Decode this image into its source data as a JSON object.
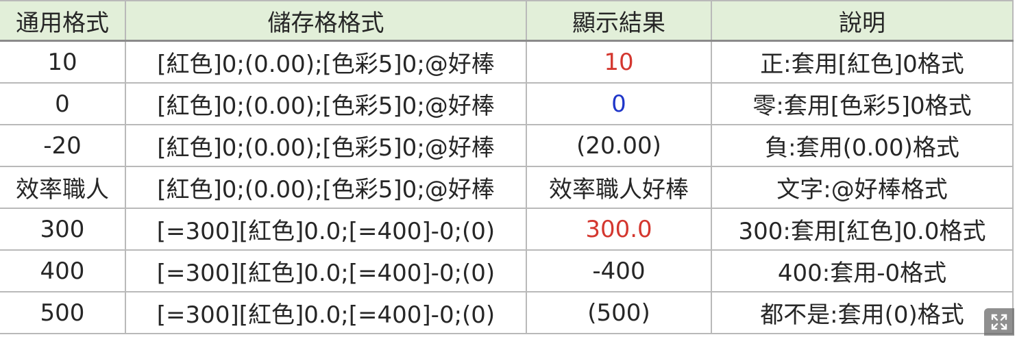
{
  "table": {
    "headers": [
      "通用格式",
      "儲存格格式",
      "顯示結果",
      "說明"
    ],
    "rows": [
      {
        "general": "10",
        "format": "[紅色]0;(0.00);[色彩5]0;@好棒",
        "result": "10",
        "desc": "正:套用[紅色]0格式",
        "result_color": "red"
      },
      {
        "general": "0",
        "format": "[紅色]0;(0.00);[色彩5]0;@好棒",
        "result": "0",
        "desc": "零:套用[色彩5]0格式",
        "result_color": "blue"
      },
      {
        "general": "-20",
        "format": "[紅色]0;(0.00);[色彩5]0;@好棒",
        "result": "(20.00)",
        "desc": "負:套用(0.00)格式",
        "result_color": "default"
      },
      {
        "general": "效率職人",
        "format": "[紅色]0;(0.00);[色彩5]0;@好棒",
        "result": "效率職人好棒",
        "desc": "文字:@好棒格式",
        "result_color": "default"
      },
      {
        "general": "300",
        "format": "[=300][紅色]0.0;[=400]-0;(0)",
        "result": "300.0",
        "desc": "300:套用[紅色]0.0格式",
        "result_color": "red"
      },
      {
        "general": "400",
        "format": "[=300][紅色]0.0;[=400]-0;(0)",
        "result": "-400",
        "desc": "400:套用-0格式",
        "result_color": "default"
      },
      {
        "general": "500",
        "format": "[=300][紅色]0.0;[=400]-0;(0)",
        "result": "(500)",
        "desc": "都不是:套用(0)格式",
        "result_color": "default"
      }
    ]
  },
  "colors": {
    "header_bg": "#e2efd9",
    "red": "#d4372f",
    "blue": "#1f36c9",
    "text": "#262626",
    "grid": "#b9b9b9"
  },
  "icons": {
    "expand": "expand-arrows-icon"
  }
}
